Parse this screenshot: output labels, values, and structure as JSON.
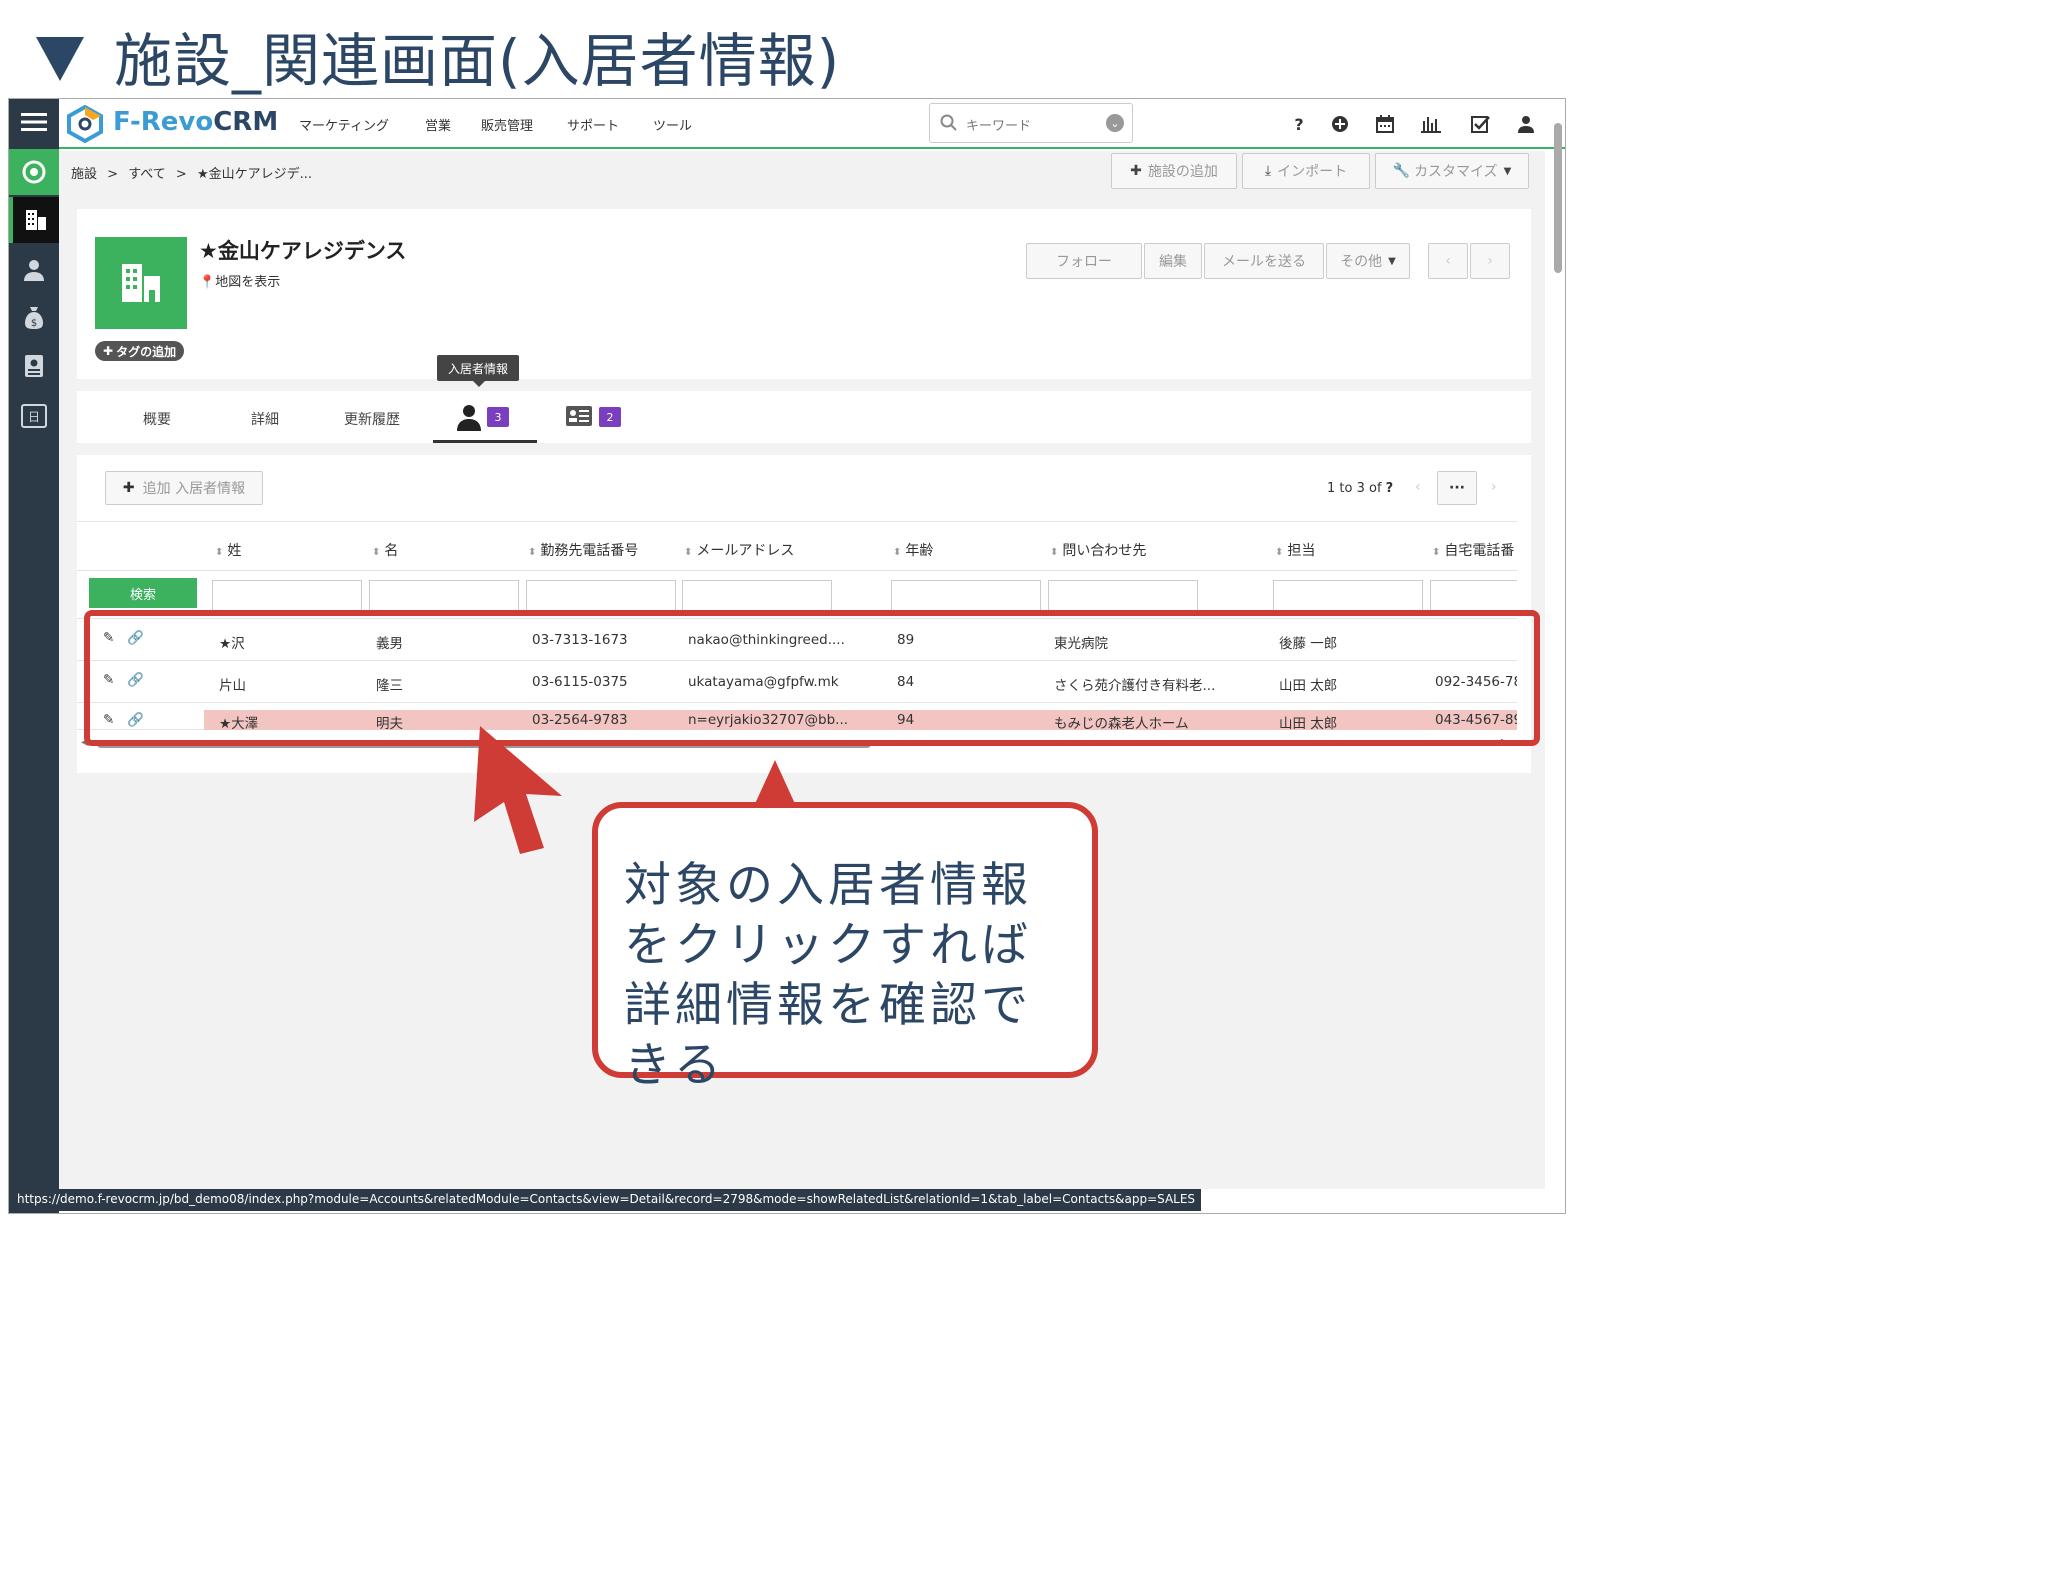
{
  "slide": {
    "title": "施設_関連画面(入居者情報)"
  },
  "app": {
    "brand": "F-RevoCRM",
    "brand_prefix": "F-Revo",
    "brand_suffix": "CRM",
    "accent": "#3cb15e"
  },
  "nav": {
    "items": [
      "マーケティング",
      "営業",
      "販売管理",
      "サポート",
      "ツール"
    ],
    "search_placeholder": "キーワード"
  },
  "breadcrumb": {
    "items": [
      "施設",
      "すべて",
      "★金山ケアレジデ..."
    ],
    "sep": ">"
  },
  "actions": {
    "add": "施設の追加",
    "import": "インポート",
    "customize": "カスタマイズ"
  },
  "record": {
    "name": "★金山ケアレジデンス",
    "map_link": "地図を表示",
    "tag_add": "タグの追加",
    "buttons": {
      "follow": "フォロー",
      "edit": "編集",
      "send_mail": "メールを送る",
      "more": "その他"
    }
  },
  "tabs": {
    "overview": "概要",
    "detail": "詳細",
    "history": "更新履歴",
    "residents_tooltip": "入居者情報",
    "residents_count": "3",
    "cards_count": "2"
  },
  "related": {
    "add_button": "追加 入居者情報",
    "pagination": "1 to 3",
    "of_label": "of",
    "total_unknown": "?",
    "more": "···",
    "search_button": "検索"
  },
  "table": {
    "columns": [
      "姓",
      "名",
      "勤務先電話番号",
      "メールアドレス",
      "年齢",
      "問い合わせ先",
      "担当",
      "自宅電話番"
    ],
    "rows": [
      {
        "last": "★沢",
        "first": "義男",
        "work_phone": "03-7313-1673",
        "email": "nakao@thinkingreed....",
        "age": "89",
        "contact": "東光病院",
        "owner": "後藤 一郎",
        "home_phone": ""
      },
      {
        "last": "片山",
        "first": "隆三",
        "work_phone": "03-6115-0375",
        "email": "ukatayama@gfpfw.mk",
        "age": "84",
        "contact": "さくら苑介護付き有料老...",
        "owner": "山田 太郎",
        "home_phone": "092-3456-78"
      },
      {
        "last": "★大澤",
        "first": "明夫",
        "work_phone": "03-2564-9783",
        "email": "n=eyrjakio32707@bb...",
        "age": "94",
        "contact": "もみじの森老人ホーム",
        "owner": "山田 太郎",
        "home_phone": "043-4567-89"
      }
    ]
  },
  "callout": {
    "text": "対象の入居者情報をクリックすれば詳細情報を確認できる",
    "color": "#cf3b35",
    "text_color": "#2c4766"
  },
  "status_url": "https://demo.f-revocrm.jp/bd_demo08/index.php?module=Accounts&relatedModule=Contacts&view=Detail&record=2798&mode=showRelatedList&relationId=1&tab_label=Contacts&app=SALES"
}
